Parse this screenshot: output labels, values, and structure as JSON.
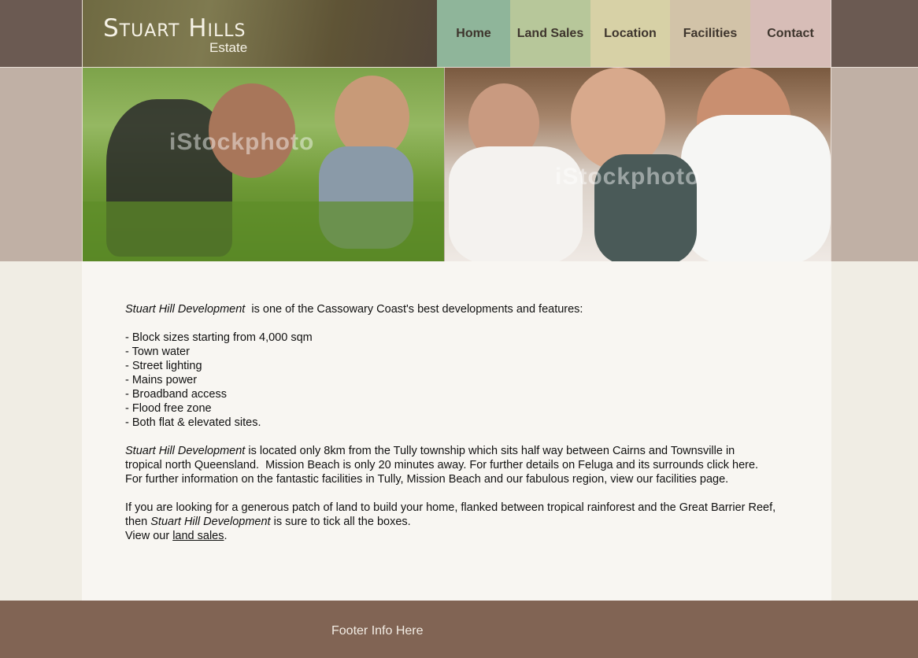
{
  "header": {
    "logo_main": "Stuart Hills",
    "logo_sub": "Estate"
  },
  "nav": {
    "items": [
      {
        "label": "Home",
        "color": "#8fb59a"
      },
      {
        "label": "Land Sales",
        "color": "#b7c79a"
      },
      {
        "label": "Location",
        "color": "#d7d1a6"
      },
      {
        "label": "Facilities",
        "color": "#d2c3a8"
      },
      {
        "label": "Contact",
        "color": "#d7bdb7"
      }
    ]
  },
  "photos": {
    "watermark": "iStockphoto"
  },
  "content": {
    "intro_em": "Stuart Hill Development",
    "intro_rest": "  is one of the Cassowary Coast's best developments and features:",
    "features": [
      "- Block sizes starting from 4,000 sqm",
      "- Town water",
      "- Street lighting",
      "- Mains power",
      "- Broadband access",
      "- Flood free zone",
      "- Both flat & elevated sites."
    ],
    "para2_em": "Stuart Hill Development",
    "para2_rest": " is located only 8km from the Tully township which sits half way between Cairns and Townsville in tropical north Queensland.  Mission Beach is only 20 minutes away. For further details on Feluga and its surrounds click here.  For further information on the fantastic facilities in Tully, Mission Beach and our fabulous region, view our facilities page.",
    "para3_start": "If you are looking for a generous patch of land to build your home, flanked between tropical rainforest and the Great Barrier Reef, then ",
    "para3_em": "Stuart Hill Development",
    "para3_end": " is sure to tick all the boxes.",
    "view_prefix": "View our ",
    "view_link": "land sales",
    "view_suffix": "."
  },
  "footer": {
    "text": "Footer Info Here"
  }
}
